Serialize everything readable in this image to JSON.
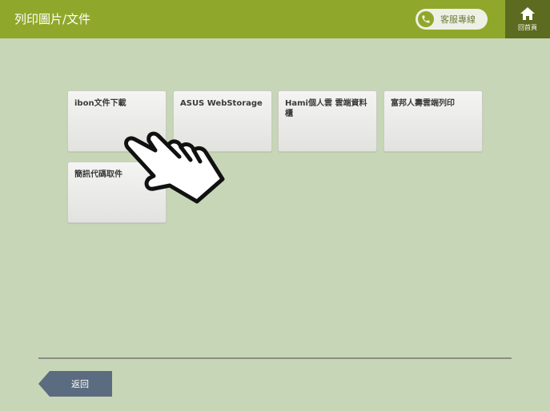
{
  "header": {
    "title": "列印圖片/文件",
    "hotline_label": "客服專線",
    "home_label": "回首頁",
    "bg_color": "#8fa82b"
  },
  "tiles": [
    {
      "label": "ibon文件下載"
    },
    {
      "label": "ASUS WebStorage"
    },
    {
      "label": "Hami個人雲 雲端資料櫃"
    },
    {
      "label": "富邦人壽雲端列印"
    },
    {
      "label": "簡訊代碼取件"
    }
  ],
  "footer": {
    "back_label": "返回"
  },
  "icons": {
    "hotline": "phone-icon",
    "home": "home-icon",
    "overlay": "pointing-hand-icon"
  }
}
